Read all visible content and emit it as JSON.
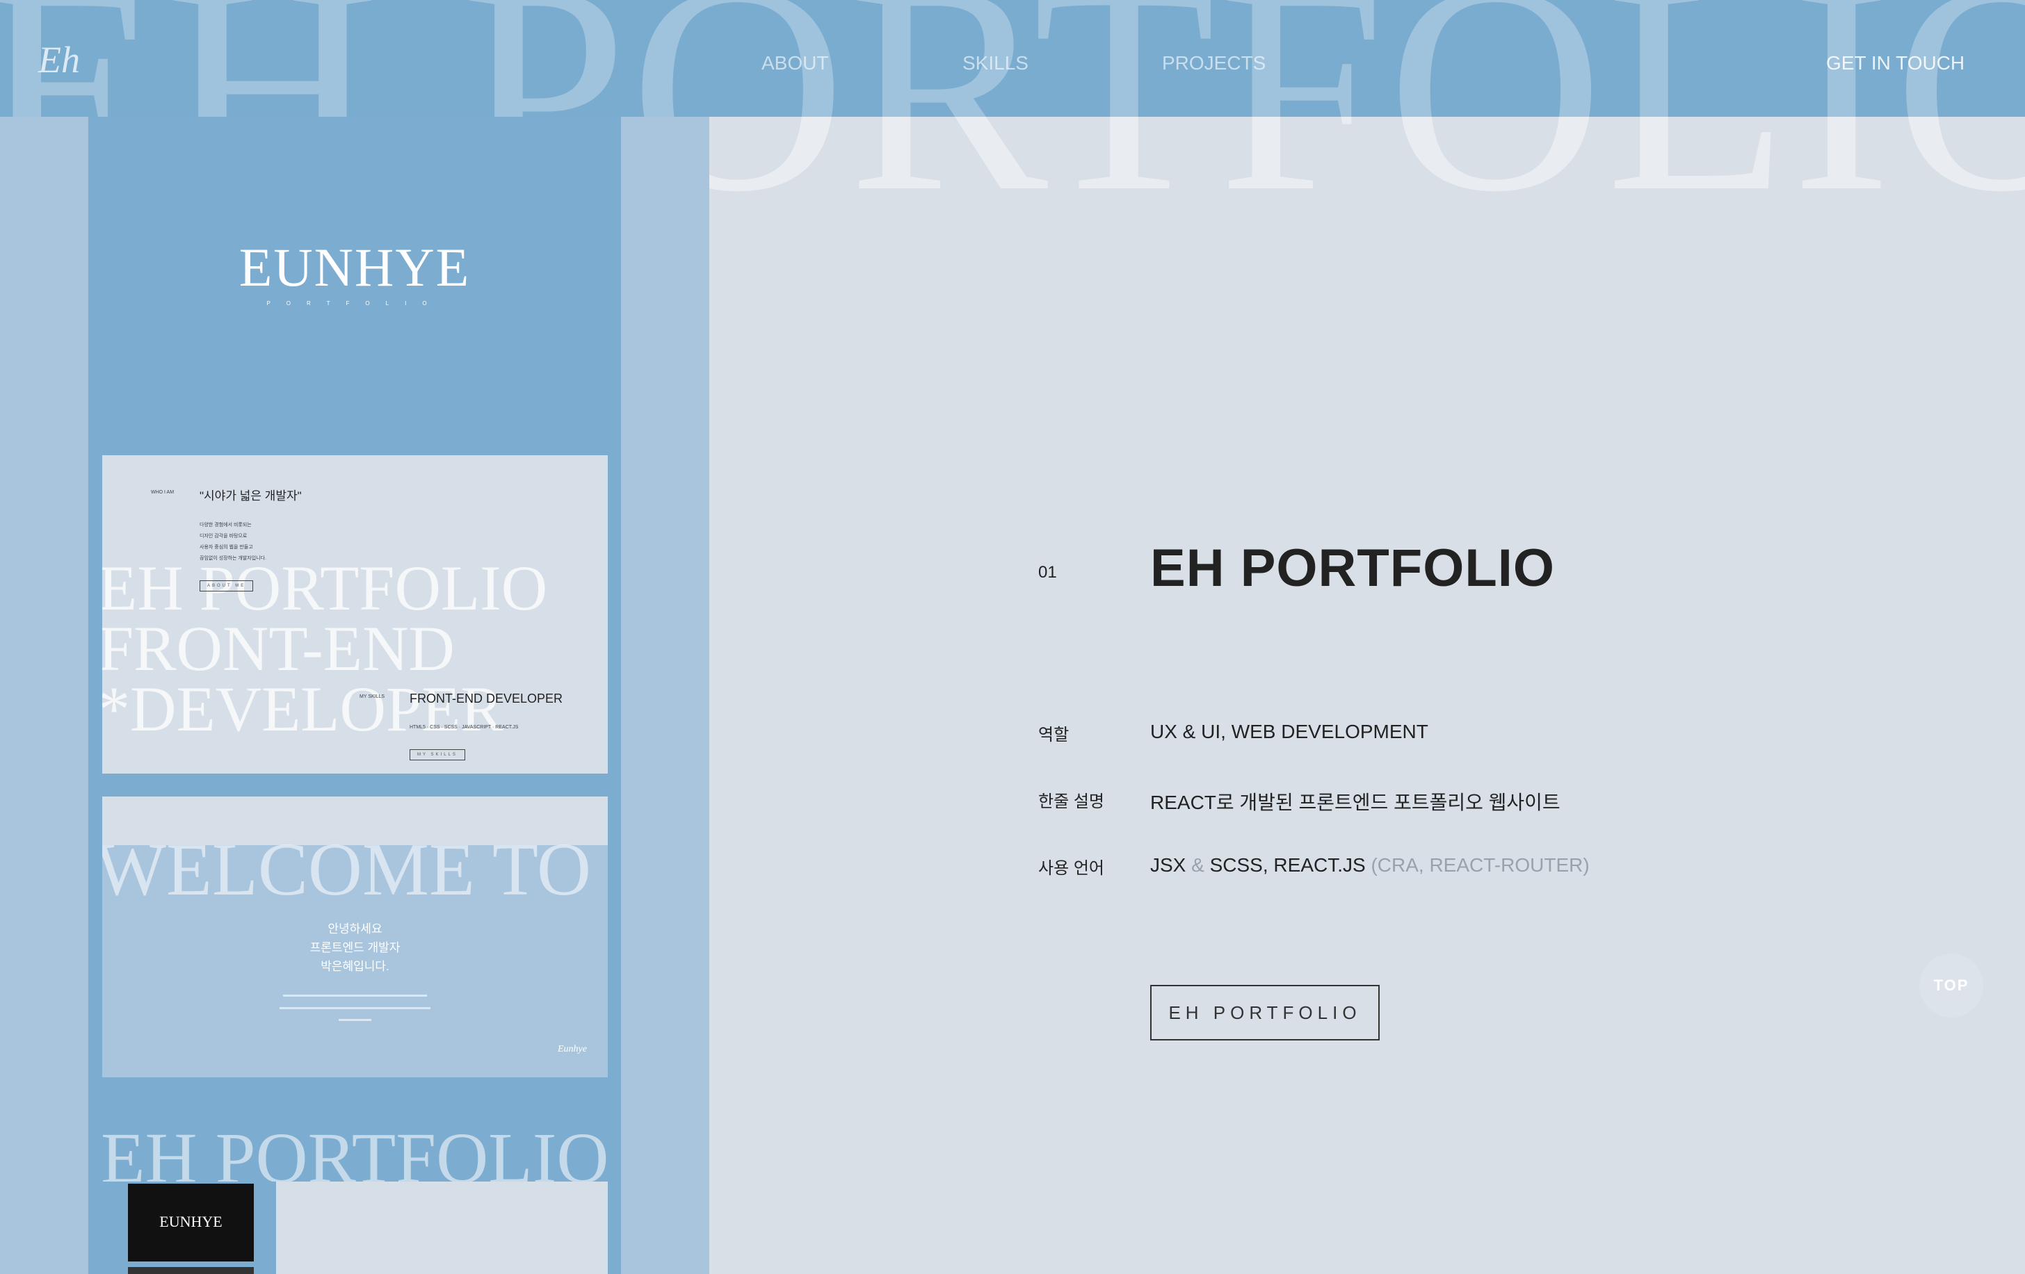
{
  "header": {
    "logo": "Eh",
    "bg_title": "EH PORTFOLIO",
    "nav": [
      "ABOUT",
      "SKILLS",
      "PROJECTS"
    ],
    "cta": "GET IN TOUCH"
  },
  "showcase": {
    "logo": "EUNHYE",
    "logo_sub": "PORTFOLIO",
    "shot1": {
      "tag": "WHO I AM",
      "quote": "\"시야가 넓은 개발자\"",
      "lines": [
        "다양한 경험에서 비롯되는",
        "디자인 감각을 바탕으로",
        "사용자 중심의 웹을 만들고",
        "끊임없이 성장하는 개발자입니다."
      ],
      "about_btn": "ABOUT ME",
      "big_lines": [
        "EH PORTFOLIO",
        "FRONT-END",
        "*DEVELOPER"
      ],
      "skills_tag": "MY SKILLS",
      "skills_title": "FRONT-END DEVELOPER",
      "skills_list": "HTML5 · CSS · SCSS · JAVASCRIPT · REACT.JS",
      "skills_btn": "MY SKILLS"
    },
    "shot2": {
      "big": "WELCOME TO EH",
      "lines": [
        "안녕하세요",
        "프론트엔드 개발자",
        "박은혜입니다."
      ],
      "sign": "Eunhye"
    },
    "shot3": {
      "big": "EH PORTFOLIO",
      "logo": "EUNHYE"
    }
  },
  "project": {
    "number": "01",
    "title": "EH PORTFOLIO",
    "rows": [
      {
        "label": "역할",
        "value": "UX & UI, WEB DEVELOPMENT"
      },
      {
        "label": "한줄 설명",
        "value": "REACT로 개발된 프론트엔드 포트폴리오 웹사이트"
      },
      {
        "label": "사용 언어",
        "value_a": "JSX",
        "amp": "&",
        "value_b": "SCSS, REACT.JS",
        "note": "(CRA, REACT-ROUTER)"
      }
    ],
    "button": "EH PORTFOLIO"
  },
  "top_button": "TOP"
}
